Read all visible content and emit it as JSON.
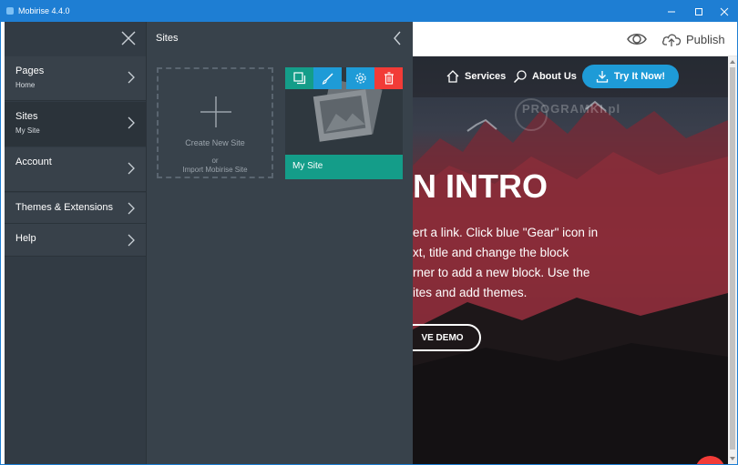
{
  "window": {
    "title": "Mobirise 4.4.0"
  },
  "menu": {
    "items": [
      {
        "label": "Pages",
        "sub": "Home"
      },
      {
        "label": "Sites",
        "sub": "My Site"
      },
      {
        "label": "Account",
        "sub": ""
      },
      {
        "label": "Themes & Extensions",
        "sub": ""
      },
      {
        "label": "Help",
        "sub": ""
      }
    ]
  },
  "sites_panel": {
    "title": "Sites",
    "create_label": "Create New Site",
    "or_label": "or",
    "import_label": "Import Mobirise Site",
    "site_name": "My Site"
  },
  "toolbar": {
    "publish_label": "Publish"
  },
  "preview": {
    "nav": {
      "services": "Services",
      "about": "About Us",
      "try": "Try It Now!"
    },
    "watermark": "PROGRAMKI.pl",
    "headline": "N INTRO",
    "paragraph": [
      "ert a link. Click blue \"Gear\" icon in",
      "xt, title and change the block",
      "rner to add a new block. Use the",
      "ites and add themes."
    ],
    "demo_button": "VE DEMO"
  },
  "colors": {
    "titlebar": "#1e7ed3",
    "accent_teal": "#149d89",
    "accent_blue": "#1e9bd7",
    "delete_red": "#f23b37",
    "menu_bg": "#323b44"
  }
}
